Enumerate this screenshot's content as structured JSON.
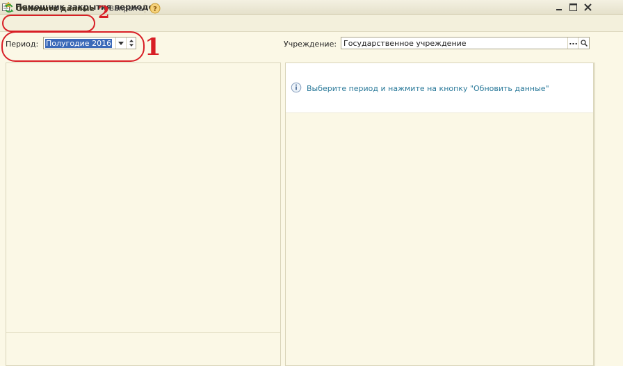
{
  "window": {
    "title": "Помощник закрытия периодов",
    "controls": [
      "minimize-icon",
      "maximize-icon",
      "close-icon"
    ]
  },
  "toolbar": {
    "refresh_label": "Обновить данные",
    "close_label": "Закрыть",
    "help_icon": "question-icon"
  },
  "filters": {
    "period_label": "Период:",
    "period_value": "Полугодие 2016",
    "institution_label": "Учреждение:",
    "institution_value": "Государственное учреждение",
    "institution_choose": "..."
  },
  "main": {
    "message": "Выберите период и нажмите на кнопку \"Обновить данные\""
  },
  "annotations": {
    "marker_1": "1",
    "marker_2": "2"
  },
  "colors": {
    "background": "#fbf8e6",
    "selection": "#3a69b8",
    "info_text": "#2b7a9a",
    "annotation": "#d81f26"
  }
}
